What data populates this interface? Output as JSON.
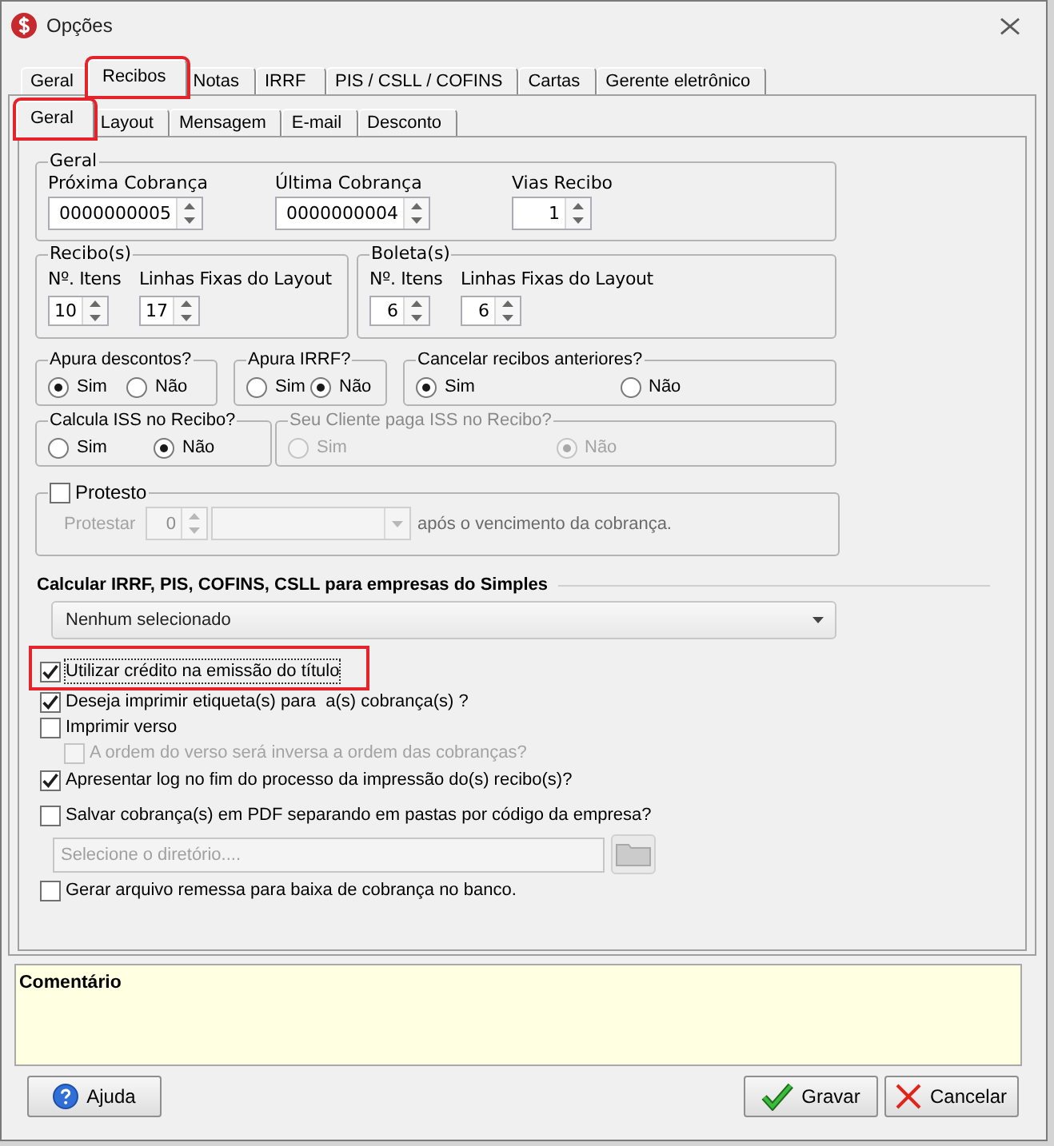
{
  "window": {
    "title": "Opções"
  },
  "tabs": [
    {
      "label": "Geral",
      "selected": false,
      "highlighted": false
    },
    {
      "label": "Recibos",
      "selected": true,
      "highlighted": true
    },
    {
      "label": "Notas",
      "selected": false,
      "highlighted": false
    },
    {
      "label": "IRRF",
      "selected": false,
      "highlighted": false
    },
    {
      "label": "PIS / CSLL / COFINS",
      "selected": false,
      "highlighted": false
    },
    {
      "label": "Cartas",
      "selected": false,
      "highlighted": false
    },
    {
      "label": "Gerente eletrônico",
      "selected": false,
      "highlighted": false
    }
  ],
  "subtabs": [
    {
      "label": "Geral",
      "selected": true,
      "highlighted": true
    },
    {
      "label": "Layout",
      "selected": false,
      "highlighted": false
    },
    {
      "label": "Mensagem",
      "selected": false,
      "highlighted": false
    },
    {
      "label": "E-mail",
      "selected": false,
      "highlighted": false
    },
    {
      "label": "Desconto",
      "selected": false,
      "highlighted": false
    }
  ],
  "geral_group": {
    "title": "Geral",
    "fields": [
      {
        "label": "Próxima Cobrança",
        "value": "0000000005"
      },
      {
        "label": "Última Cobrança",
        "value": "0000000004"
      },
      {
        "label": "Vias Recibo",
        "value": "1"
      }
    ]
  },
  "count_groups": [
    {
      "title": "Recibo(s)",
      "fields": [
        {
          "label": "Nº. Itens",
          "value": "10"
        },
        {
          "label": "Linhas Fixas do Layout",
          "value": "17"
        }
      ]
    },
    {
      "title": "Boleta(s)",
      "fields": [
        {
          "label": "Nº. Itens",
          "value": "6"
        },
        {
          "label": "Linhas Fixas do Layout",
          "value": "6"
        }
      ]
    }
  ],
  "radio_rows": [
    [
      {
        "title": "Apura descontos?",
        "disabled": false,
        "options": [
          {
            "label": "Sim",
            "selected": true
          },
          {
            "label": "Não",
            "selected": false
          }
        ]
      },
      {
        "title": "Apura IRRF?",
        "disabled": false,
        "options": [
          {
            "label": "Sim",
            "selected": false
          },
          {
            "label": "Não",
            "selected": true
          }
        ]
      },
      {
        "title": "Cancelar recibos anteriores?",
        "disabled": false,
        "options": [
          {
            "label": "Sim",
            "selected": true
          },
          {
            "label": "Não",
            "selected": false
          }
        ]
      }
    ],
    [
      {
        "title": "Calcula ISS no Recibo?",
        "disabled": false,
        "options": [
          {
            "label": "Sim",
            "selected": false
          },
          {
            "label": "Não",
            "selected": true
          }
        ]
      },
      {
        "title": "Seu Cliente paga ISS no Recibo?",
        "disabled": true,
        "options": [
          {
            "label": "Sim",
            "selected": false
          },
          {
            "label": "Não",
            "selected": true
          }
        ]
      }
    ]
  ],
  "protesto": {
    "label": "Protesto",
    "checked": false,
    "prefix": "Protestar",
    "days": "0",
    "suffix": "após o vencimento da cobrança."
  },
  "simples": {
    "heading": "Calcular IRRF, PIS, COFINS, CSLL para empresas do Simples",
    "value": "Nenhum selecionado"
  },
  "options": [
    {
      "kind": "checkbox",
      "label": "Utilizar crédito na emissão do título",
      "checked": true,
      "disabled": false,
      "focused": true,
      "highlighted": true
    },
    {
      "kind": "checkbox",
      "label": "Deseja imprimir etiqueta(s) para  a(s) cobrança(s) ?",
      "checked": true,
      "disabled": false,
      "focused": false,
      "highlighted": false
    },
    {
      "kind": "checkbox",
      "label": "Imprimir verso",
      "checked": false,
      "disabled": false,
      "focused": false,
      "highlighted": false,
      "children": [
        {
          "kind": "checkbox",
          "label": "A ordem do verso será inversa a ordem das cobranças?",
          "checked": false,
          "disabled": true,
          "focused": false,
          "highlighted": false
        }
      ]
    },
    {
      "kind": "checkbox",
      "label": "Apresentar log no fim do processo da impressão do(s) recibo(s)?",
      "checked": true,
      "disabled": false,
      "focused": false,
      "highlighted": false
    },
    {
      "kind": "checkbox",
      "label": "Salvar cobrança(s) em PDF separando em pastas por código da empresa?",
      "checked": false,
      "disabled": false,
      "focused": false,
      "highlighted": false
    },
    {
      "kind": "directory",
      "placeholder": "Selecione o diretório....",
      "disabled": true
    },
    {
      "kind": "checkbox",
      "label": "Gerar arquivo remessa para baixa de cobrança no banco.",
      "checked": false,
      "disabled": false,
      "focused": false,
      "highlighted": false
    }
  ],
  "comment": {
    "title": "Comentário"
  },
  "buttons": [
    {
      "kind": "help",
      "label": "Ajuda"
    },
    {
      "kind": "save",
      "label": "Gravar"
    },
    {
      "kind": "cancel",
      "label": "Cancelar"
    }
  ]
}
